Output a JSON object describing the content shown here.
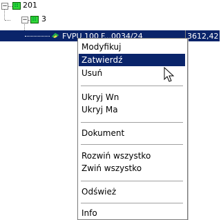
{
  "tree": {
    "node1": "201",
    "node2": "3",
    "selected_row": {
      "name": "FVPU 100",
      "doc": "F...0034/24",
      "amount": "3612,42"
    }
  },
  "context_menu": {
    "items": [
      {
        "label": "Modyfikuj"
      },
      {
        "label": "Zatwierdź"
      },
      {
        "label": "Usuń"
      },
      {
        "label": "Ukryj Wn"
      },
      {
        "label": "Ukryj Ma"
      },
      {
        "label": "Dokument"
      },
      {
        "label": "Rozwiń wszystko"
      },
      {
        "label": "Zwiń wszystko"
      },
      {
        "label": "Odśwież"
      },
      {
        "label": "Info"
      }
    ]
  },
  "colors": {
    "selection": "#0a246a",
    "folder": "#34d63a"
  }
}
